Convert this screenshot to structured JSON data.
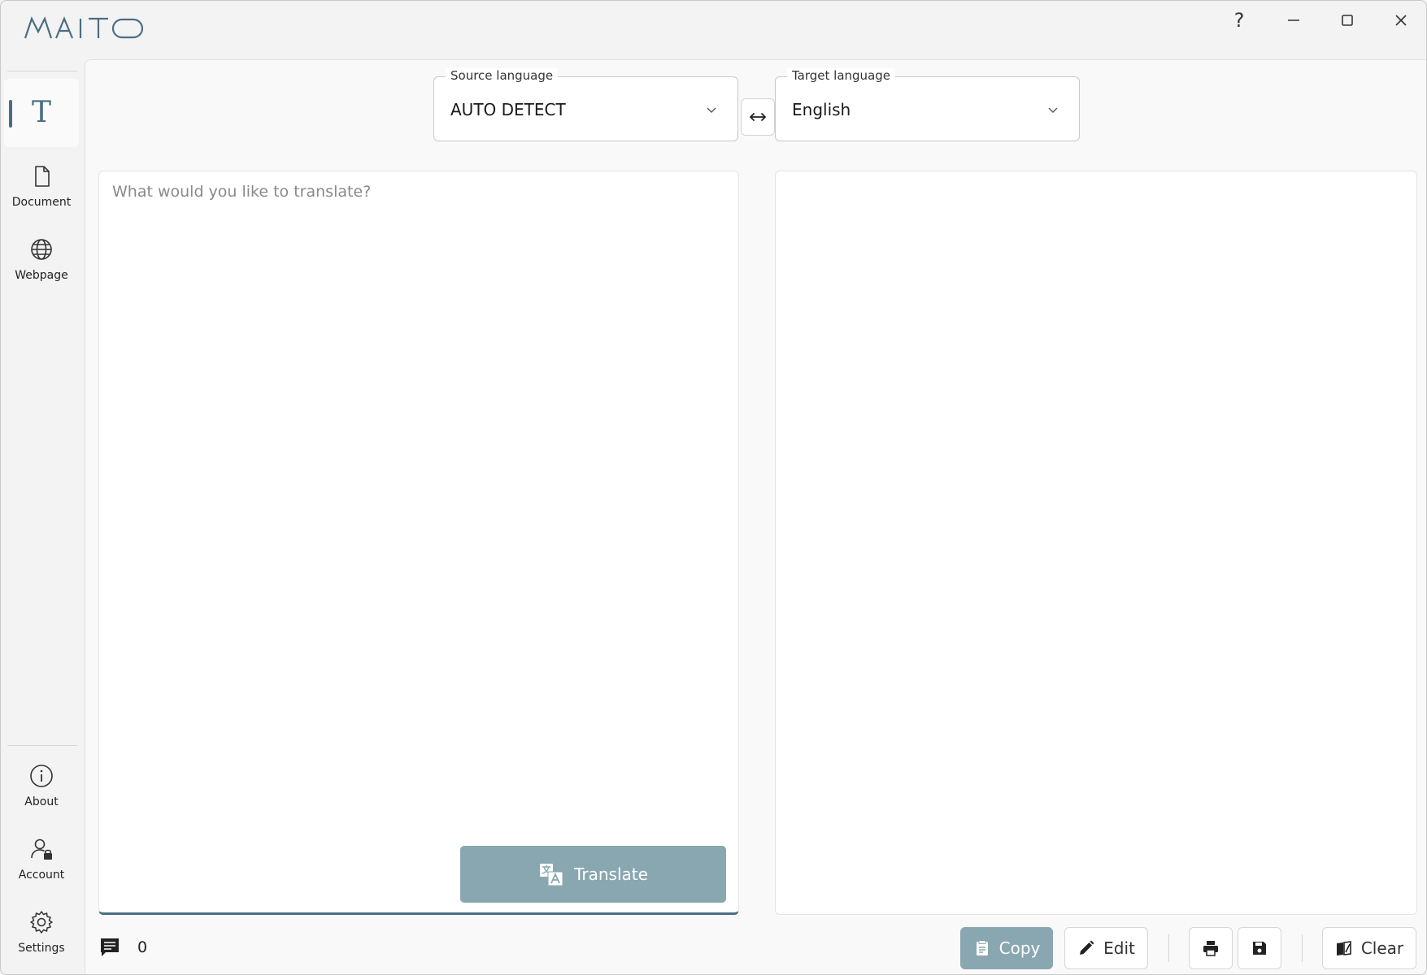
{
  "app": {
    "logo_text": "MAITO"
  },
  "titlebar": {
    "help_label": "?"
  },
  "sidebar": {
    "items": [
      {
        "label": "",
        "icon": "text-icon",
        "glyph": "T",
        "active": true
      },
      {
        "label": "Document",
        "icon": "document-icon"
      },
      {
        "label": "Webpage",
        "icon": "globe-icon"
      }
    ],
    "bottom_items": [
      {
        "label": "About",
        "icon": "info-icon"
      },
      {
        "label": "Account",
        "icon": "account-icon"
      },
      {
        "label": "Settings",
        "icon": "gear-icon"
      }
    ]
  },
  "source_language": {
    "legend": "Source language",
    "value": "AUTO DETECT"
  },
  "target_language": {
    "legend": "Target language",
    "value": "English"
  },
  "source_input": {
    "placeholder": "What would you like to translate?",
    "value": ""
  },
  "translate_button": {
    "label": "Translate"
  },
  "status": {
    "char_count": "0"
  },
  "toolbar": {
    "copy_label": "Copy",
    "edit_label": "Edit",
    "clear_label": "Clear"
  },
  "colors": {
    "accent": "#4b6d82",
    "button_fill": "#89a7b1"
  }
}
